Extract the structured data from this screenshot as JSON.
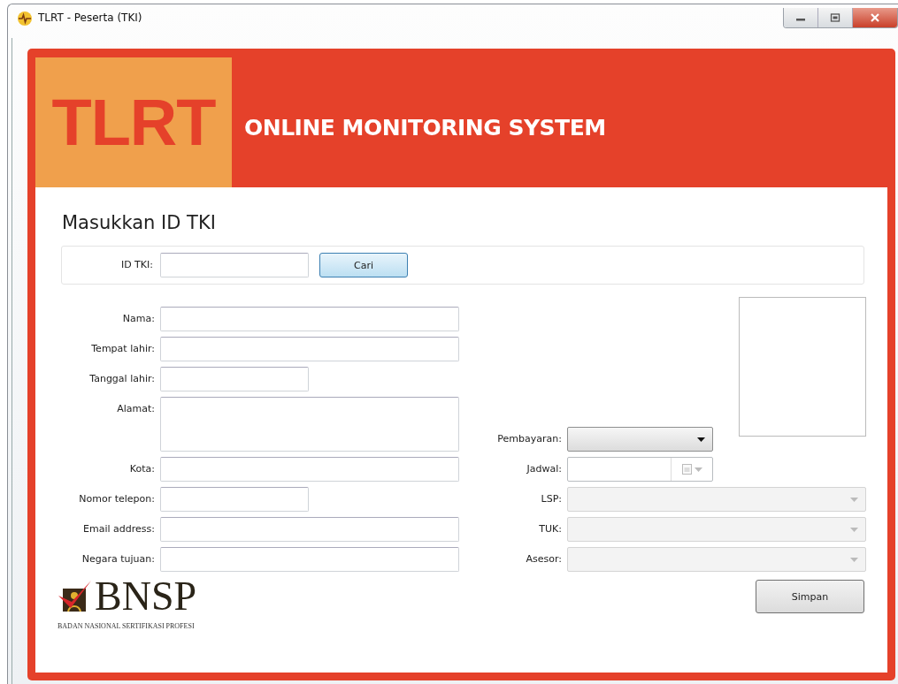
{
  "window": {
    "title": "TLRT - Peserta (TKI)"
  },
  "header": {
    "logo": "TLRT",
    "title": "ONLINE MONITORING SYSTEM"
  },
  "search": {
    "heading": "Masukkan ID TKI",
    "label": "ID TKI:",
    "button": "Cari"
  },
  "fields": [
    {
      "label": "Nama:",
      "kind": "text"
    },
    {
      "label": "Tempat lahir:",
      "kind": "text"
    },
    {
      "label": "Tanggal lahir:",
      "kind": "short"
    },
    {
      "label": "Alamat:",
      "kind": "textarea"
    },
    {
      "label": "Kota:",
      "kind": "text"
    },
    {
      "label": "Nomor telepon:",
      "kind": "short"
    },
    {
      "label": "Email address:",
      "kind": "text"
    },
    {
      "label": "Negara tujuan:",
      "kind": "text"
    }
  ],
  "schedule_fields": [
    {
      "label": "Pembayaran:",
      "kind": "dropdown",
      "disabled": false
    },
    {
      "label": "Jadwal:",
      "kind": "date",
      "disabled": false
    },
    {
      "label": "LSP:",
      "kind": "dropdown",
      "disabled": true
    },
    {
      "label": "TUK:",
      "kind": "dropdown",
      "disabled": true
    },
    {
      "label": "Asesor:",
      "kind": "dropdown",
      "disabled": true
    }
  ],
  "footer": {
    "logo": "BNSP",
    "caption": "BADAN NASIONAL SERTIFIKASI PROFESI",
    "button": "Simpan"
  }
}
